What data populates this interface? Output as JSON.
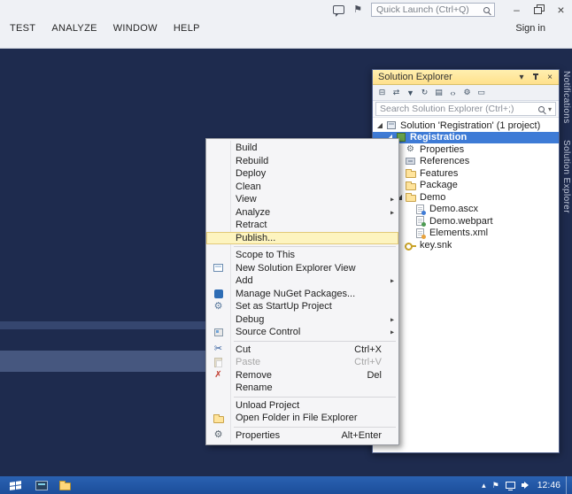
{
  "window": {
    "quick_launch_placeholder": "Quick Launch (Ctrl+Q)",
    "title_icons": [
      {
        "name": "feedback-icon",
        "glyph": ""
      },
      {
        "name": "notifications-flag-icon",
        "glyph": "⚑"
      }
    ],
    "buttons": [
      {
        "name": "minimize-button",
        "glyph": "–"
      },
      {
        "name": "restore-button",
        "glyph": ""
      },
      {
        "name": "close-button",
        "glyph": "×"
      }
    ]
  },
  "menu_bar": {
    "items": [
      "TEST",
      "ANALYZE",
      "WINDOW",
      "HELP"
    ],
    "sign_in_label": "Sign in"
  },
  "side_tabs": {
    "labels": [
      "Notifications",
      "Solution Explorer"
    ]
  },
  "solution_explorer": {
    "title": "Solution Explorer",
    "header_icons": [
      {
        "name": "window-position-icon",
        "glyph": "▾"
      },
      {
        "name": "auto-hide-pin-icon",
        "glyph": ""
      },
      {
        "name": "close-icon",
        "glyph": "×"
      }
    ],
    "toolbar_icons": [
      {
        "name": "collapse-all-icon",
        "glyph": "⊟"
      },
      {
        "name": "sync-with-active-document-icon",
        "glyph": "⇄"
      },
      {
        "name": "filter-icon",
        "glyph": "▼"
      },
      {
        "name": "refresh-icon",
        "glyph": "↻"
      },
      {
        "name": "show-all-files-icon",
        "glyph": "▤"
      },
      {
        "name": "view-code-icon",
        "glyph": "‹›"
      },
      {
        "name": "properties-icon",
        "glyph": "⚙"
      },
      {
        "name": "preview-icon",
        "glyph": "▭"
      }
    ],
    "search_placeholder": "Search Solution Explorer (Ctrl+;)",
    "search_dropdown_glyph": "▾",
    "tree": [
      {
        "label": "Solution 'Registration' (1 project)",
        "indent": 0,
        "expander": "expanded",
        "icon": "solution"
      },
      {
        "label": "Registration",
        "indent": 1,
        "expander": "expanded",
        "icon": "project",
        "selected": true
      },
      {
        "label": "Properties",
        "indent": 2,
        "icon": "properties"
      },
      {
        "label": "References",
        "indent": 2,
        "icon": "references"
      },
      {
        "label": "Features",
        "indent": 2,
        "icon": "folder"
      },
      {
        "label": "Package",
        "indent": 2,
        "icon": "folder"
      },
      {
        "label": "Demo",
        "indent": 2,
        "expander": "expanded",
        "icon": "folder"
      },
      {
        "label": "Demo.ascx",
        "indent": 3,
        "icon": "ascx"
      },
      {
        "label": "Demo.webpart",
        "indent": 3,
        "icon": "webpart"
      },
      {
        "label": "Elements.xml",
        "indent": 3,
        "icon": "xml"
      },
      {
        "label": "key.snk",
        "indent": 2,
        "icon": "key"
      }
    ]
  },
  "context_menu": {
    "items": [
      {
        "label": "Build"
      },
      {
        "label": "Rebuild"
      },
      {
        "label": "Deploy"
      },
      {
        "label": "Clean"
      },
      {
        "label": "View",
        "submenu": true
      },
      {
        "label": "Analyze",
        "submenu": true
      },
      {
        "label": "Retract"
      },
      {
        "label": "Publish...",
        "highlighted": true
      },
      {
        "separator": true
      },
      {
        "label": "Scope to This"
      },
      {
        "label": "New Solution Explorer View",
        "icon": "new-view"
      },
      {
        "label": "Add",
        "submenu": true
      },
      {
        "label": "Manage NuGet Packages...",
        "icon": "nuget"
      },
      {
        "label": "Set as StartUp Project",
        "icon": "startup"
      },
      {
        "label": "Debug",
        "submenu": true
      },
      {
        "label": "Source Control",
        "icon": "source-control",
        "submenu": true
      },
      {
        "separator": true
      },
      {
        "label": "Cut",
        "icon": "cut",
        "shortcut": "Ctrl+X"
      },
      {
        "label": "Paste",
        "icon": "paste",
        "shortcut": "Ctrl+V",
        "disabled": true
      },
      {
        "label": "Remove",
        "icon": "remove",
        "shortcut": "Del"
      },
      {
        "label": "Rename"
      },
      {
        "separator": true
      },
      {
        "label": "Unload Project"
      },
      {
        "label": "Open Folder in File Explorer",
        "icon": "open-folder"
      },
      {
        "separator": true
      },
      {
        "label": "Properties",
        "icon": "wrench",
        "shortcut": "Alt+Enter"
      }
    ]
  },
  "taskbar": {
    "time": "12:46",
    "app_icons": [
      {
        "name": "server-manager-icon"
      },
      {
        "name": "file-explorer-icon"
      }
    ],
    "tray_icons": [
      {
        "name": "hidden-icons-chevron-icon",
        "glyph": "▴"
      },
      {
        "name": "action-center-flag-icon",
        "glyph": "⚑"
      },
      {
        "name": "network-icon",
        "glyph": ""
      },
      {
        "name": "volume-icon",
        "glyph": ""
      }
    ]
  },
  "colors": {
    "editor_navy": "#1E2B4E",
    "selection_blue": "#3E7BD6",
    "menu_highlight_gold": "#FDF4BF",
    "tool_window_header_gold": "#FFE18C",
    "taskbar_blue": "#2157A5"
  }
}
